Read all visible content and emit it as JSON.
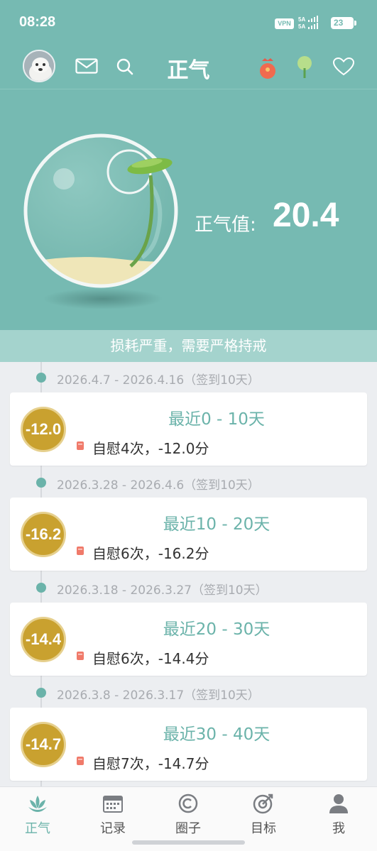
{
  "status_bar": {
    "time": "08:28",
    "vpn": "VPN",
    "signal_1": "5A",
    "signal_2": "5A",
    "battery": "23"
  },
  "header": {
    "title": "正气",
    "icons": [
      "mail-icon",
      "search-icon",
      "red-envelope-icon",
      "tree-icon",
      "heart-icon"
    ]
  },
  "hero": {
    "label": "正气值:",
    "value": "20.4"
  },
  "banner": "损耗严重，需要严格持戒",
  "periods": [
    {
      "date": "2026.4.7 - 2026.4.16（签到10天）",
      "title": "最近0 - 10天",
      "score": "-12.0",
      "desc": "自慰4次，-12.0分"
    },
    {
      "date": "2026.3.28 - 2026.4.6（签到10天）",
      "title": "最近10 - 20天",
      "score": "-16.2",
      "desc": "自慰6次，-16.2分"
    },
    {
      "date": "2026.3.18 - 2026.3.27（签到10天）",
      "title": "最近20 - 30天",
      "score": "-14.4",
      "desc": "自慰6次，-14.4分"
    },
    {
      "date": "2026.3.8 - 2026.3.17（签到10天）",
      "title": "最近30 - 40天",
      "score": "-14.7",
      "desc": "自慰7次，-14.7分"
    }
  ],
  "nav": [
    {
      "label": "正气",
      "icon": "lotus-icon",
      "active": true
    },
    {
      "label": "记录",
      "icon": "calendar-icon",
      "active": false
    },
    {
      "label": "圈子",
      "icon": "circle-icon",
      "active": false
    },
    {
      "label": "目标",
      "icon": "target-icon",
      "active": false
    },
    {
      "label": "我",
      "icon": "person-icon",
      "active": false
    }
  ],
  "colors": {
    "teal": "#76bab2",
    "accent": "#6bb3aa",
    "coin": "#c9a12f",
    "banner": "#a4d3cd"
  }
}
